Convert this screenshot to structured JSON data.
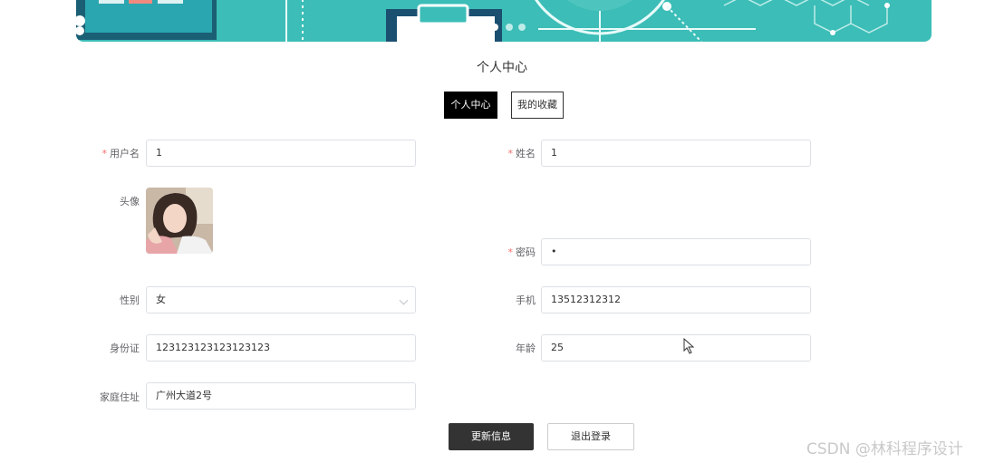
{
  "page": {
    "title": "个人中心"
  },
  "tabs": [
    {
      "label": "个人中心"
    },
    {
      "label": "我的收藏"
    }
  ],
  "form": {
    "username": {
      "label": "用户名",
      "value": "1"
    },
    "name": {
      "label": "姓名",
      "value": "1"
    },
    "avatar": {
      "label": "头像"
    },
    "password": {
      "label": "密码",
      "value": "•"
    },
    "gender": {
      "label": "性别",
      "value": "女"
    },
    "phone": {
      "label": "手机",
      "value": "13512312312"
    },
    "id_card": {
      "label": "身份证",
      "value": "123123123123123123"
    },
    "age": {
      "label": "年龄",
      "value": "25"
    },
    "address": {
      "label": "家庭住址",
      "value": "广州大道2号"
    },
    "required_mark": "*"
  },
  "buttons": {
    "update": "更新信息",
    "logout": "退出登录"
  },
  "watermark": "CSDN @林科程序设计",
  "colors": {
    "banner": "#3cbdb7",
    "required": "#f56c6c",
    "primary_button": "#333333"
  }
}
